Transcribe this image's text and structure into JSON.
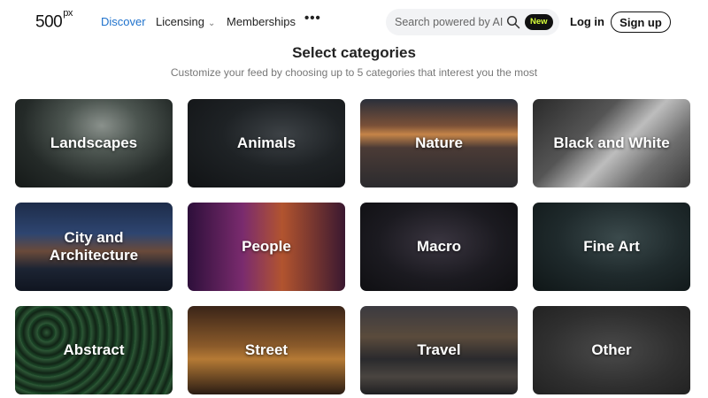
{
  "nav": {
    "logo_text": "500",
    "logo_suffix": "px",
    "links": [
      "Discover",
      "Licensing",
      "Memberships"
    ],
    "more_label": "•••",
    "search_placeholder": "Search powered by AI",
    "new_badge": "New",
    "login_label": "Log in",
    "signup_label": "Sign up"
  },
  "header": {
    "title": "Select categories",
    "subtitle": "Customize your feed by choosing up to 5 categories that interest you the most"
  },
  "categories": [
    "Landscapes",
    "Animals",
    "Nature",
    "Black and White",
    "City and Architecture",
    "People",
    "Macro",
    "Fine Art",
    "Abstract",
    "Street",
    "Travel",
    "Other"
  ],
  "colors": {
    "accent": "#1f72cc",
    "badge_text": "#d7ff3a",
    "badge_bg": "#111111"
  }
}
